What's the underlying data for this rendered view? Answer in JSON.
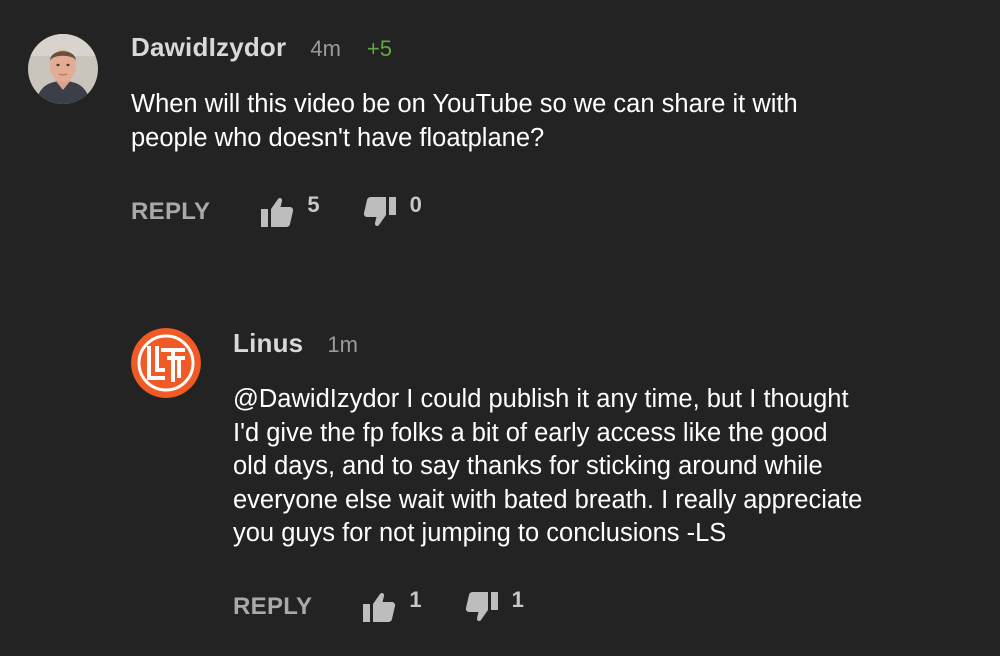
{
  "comments": [
    {
      "username": "DawidIzydor",
      "time": "4m",
      "score": "+5",
      "text_lines": [
        "When will this video be on YouTube so we can share it with",
        "people who doesn't have floatplane?"
      ],
      "reply_label": "REPLY",
      "likes": "5",
      "dislikes": "0",
      "avatar_icon": "user-photo-avatar"
    },
    {
      "username": "Linus",
      "time": "1m",
      "text_lines": [
        "@DawidIzydor I could publish it any time, but I thought",
        "I'd give the fp folks a bit of early access like the good",
        "old days, and to say thanks for sticking around while",
        "everyone else wait with bated breath. I really appreciate",
        "you guys for not jumping to conclusions -LS"
      ],
      "reply_label": "REPLY",
      "likes": "1",
      "dislikes": "1",
      "avatar_icon": "ltt-logo-avatar"
    }
  ],
  "colors": {
    "background": "#232323",
    "username": "#d9d9d9",
    "timestamp": "#9b9b9b",
    "score_positive": "#5fa843",
    "ltt_orange": "#f15a24"
  },
  "icons": [
    "thumbs-up-icon",
    "thumbs-down-icon"
  ]
}
